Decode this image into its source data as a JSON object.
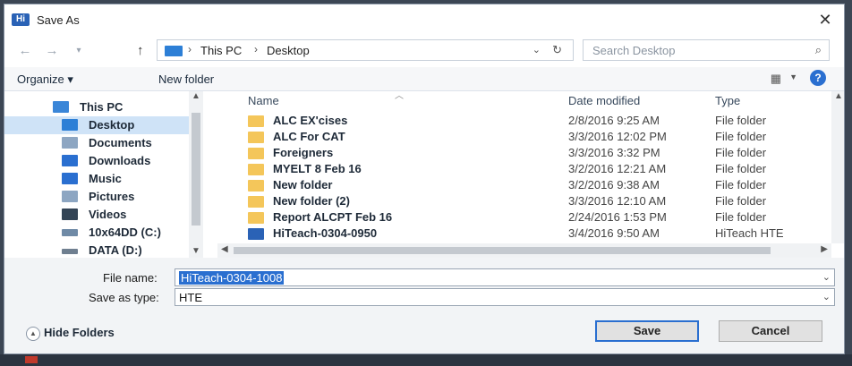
{
  "window": {
    "title": "Save As",
    "app_badge": "Hi"
  },
  "icons": {
    "app": "hiteach-logo-icon",
    "close": "close-icon",
    "back": "back-arrow-icon",
    "forward": "forward-arrow-icon",
    "up": "up-arrow-icon",
    "refresh": "refresh-icon",
    "search": "search-icon",
    "view": "view-options-icon",
    "help": "help-icon"
  },
  "address": {
    "location_icon": "this-pc-icon",
    "crumbs": [
      "This PC",
      "Desktop"
    ]
  },
  "search": {
    "placeholder": "Search Desktop"
  },
  "toolbar": {
    "organize": "Organize ▾",
    "new_folder": "New folder",
    "help_label": "?"
  },
  "nav_pane": {
    "items": [
      {
        "label": "This PC",
        "icon": "computer-icon",
        "color": "#3a86d8"
      },
      {
        "label": "Desktop",
        "icon": "desktop-icon",
        "color": "#2d7fd6",
        "selected": true
      },
      {
        "label": "Documents",
        "icon": "documents-icon",
        "color": "#8da6c2"
      },
      {
        "label": "Downloads",
        "icon": "downloads-icon",
        "color": "#2a6fd0"
      },
      {
        "label": "Music",
        "icon": "music-icon",
        "color": "#2a6fd0"
      },
      {
        "label": "Pictures",
        "icon": "pictures-icon",
        "color": "#8da6c2"
      },
      {
        "label": "Videos",
        "icon": "videos-icon",
        "color": "#334455"
      },
      {
        "label": "10x64DD (C:)",
        "icon": "drive-icon",
        "color": "#6f8aa6"
      },
      {
        "label": "DATA (D:)",
        "icon": "drive-icon",
        "color": "#6f7f90"
      }
    ]
  },
  "file_list": {
    "columns": {
      "name": "Name",
      "date": "Date modified",
      "type": "Type"
    },
    "rows": [
      {
        "name": "ALC EX'cises",
        "date": "2/8/2016 9:25 AM",
        "type": "File folder",
        "icon": "folder-icon"
      },
      {
        "name": "ALC For CAT",
        "date": "3/3/2016 12:02 PM",
        "type": "File folder",
        "icon": "folder-icon"
      },
      {
        "name": "Foreigners",
        "date": "3/3/2016 3:32 PM",
        "type": "File folder",
        "icon": "folder-icon"
      },
      {
        "name": "MYELT 8 Feb 16",
        "date": "3/2/2016 12:21 AM",
        "type": "File folder",
        "icon": "folder-icon"
      },
      {
        "name": "New folder",
        "date": "3/2/2016 9:38 AM",
        "type": "File folder",
        "icon": "folder-icon"
      },
      {
        "name": "New folder (2)",
        "date": "3/3/2016 12:10 AM",
        "type": "File folder",
        "icon": "folder-icon"
      },
      {
        "name": "Report ALCPT Feb 16",
        "date": "2/24/2016 1:53 PM",
        "type": "File folder",
        "icon": "folder-icon"
      },
      {
        "name": "HiTeach-0304-0950",
        "date": "3/4/2016 9:50 AM",
        "type": "HiTeach HTE",
        "icon": "hte-file-icon"
      }
    ]
  },
  "form": {
    "file_name_label": "File name:",
    "file_name_value": "HiTeach-0304-1008",
    "save_type_label": "Save as type:",
    "save_type_value": "HTE"
  },
  "footer": {
    "hide_folders": "Hide Folders",
    "save": "Save",
    "cancel": "Cancel"
  },
  "colors": {
    "accent": "#2a6fd0",
    "selection": "#cfe3f7",
    "folder": "#f4c65a"
  }
}
